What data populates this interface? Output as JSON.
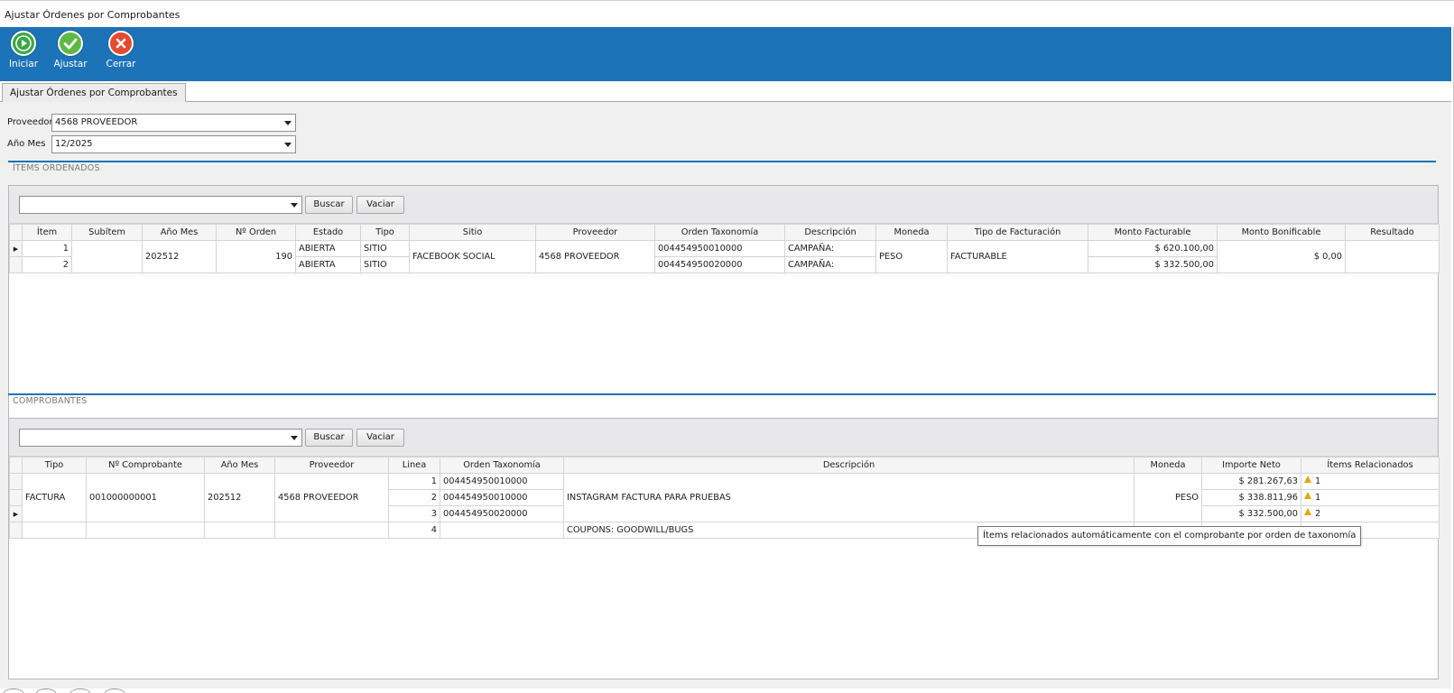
{
  "window": {
    "title": "Ajustar Órdenes por Comprobantes"
  },
  "toolbar": {
    "iniciar_label": "Iniciar",
    "ajustar_label": "Ajustar",
    "cerrar_label": "Cerrar",
    "colors": {
      "ribbon": "#1c73b7",
      "iniciar": "#3aa843",
      "ajustar": "#5fb845",
      "cerrar": "#e24b2f"
    }
  },
  "tab": {
    "label": "Ajustar Órdenes por Comprobantes"
  },
  "filters": {
    "proveedor_label": "Proveedor",
    "proveedor_value": "4568 PROVEEDOR",
    "anio_mes_label": "Año Mes",
    "anio_mes_value": "12/2025"
  },
  "items_section": {
    "title": "ÍTEMS ORDENADOS",
    "search_value": "",
    "buscar_label": "Buscar",
    "vaciar_label": "Vaciar",
    "columns": [
      "Ítem",
      "Subítem",
      "Año Mes",
      "Nº Orden",
      "Estado",
      "Tipo",
      "Sitio",
      "Proveedor",
      "Orden Taxonomía",
      "Descripción",
      "Moneda",
      "Tipo de Facturación",
      "Monto Facturable",
      "Monto Bonificable",
      "Resultado"
    ],
    "shared": {
      "anio_mes": "202512",
      "nro_orden": "190",
      "sitio": "FACEBOOK SOCIAL",
      "proveedor": "4568 PROVEEDOR",
      "moneda": "PESO",
      "tipo_facturacion": "FACTURABLE",
      "monto_bonificable": "$ 0,00",
      "resultado": ""
    },
    "rows": [
      {
        "item": "1",
        "subitem": "",
        "estado": "ABIERTA",
        "tipo": "SITIO",
        "orden_taxonomia": "004454950010000",
        "descripcion": "CAMPAÑA:",
        "monto_facturable": "$ 620.100,00"
      },
      {
        "item": "2",
        "subitem": "",
        "estado": "ABIERTA",
        "tipo": "SITIO",
        "orden_taxonomia": "004454950020000",
        "descripcion": "CAMPAÑA:",
        "monto_facturable": "$ 332.500,00"
      }
    ]
  },
  "comprobantes_section": {
    "title": "COMPROBANTES",
    "search_value": "",
    "buscar_label": "Buscar",
    "vaciar_label": "Vaciar",
    "columns": [
      "Tipo",
      "Nº Comprobante",
      "Año Mes",
      "Proveedor",
      "Linea",
      "Orden Taxonomía",
      "Descripción",
      "Moneda",
      "Importe Neto",
      "Ítems Relacionados"
    ],
    "shared": {
      "tipo": "FACTURA",
      "nro_comprobante": "001000000001",
      "anio_mes": "202512",
      "proveedor": "4568 PROVEEDOR",
      "descripcion": "INSTAGRAM FACTURA PARA PRUEBAS",
      "moneda": "PESO"
    },
    "rows": [
      {
        "linea": "1",
        "orden_taxonomia": "004454950010000",
        "importe_neto": "$ 281.267,63",
        "items_relacionados": "1"
      },
      {
        "linea": "2",
        "orden_taxonomia": "004454950010000",
        "importe_neto": "$ 338.811,96",
        "items_relacionados": "1"
      },
      {
        "linea": "3",
        "orden_taxonomia": "004454950020000",
        "importe_neto": "$ 332.500,00",
        "items_relacionados": "2"
      },
      {
        "linea": "4",
        "orden_taxonomia": "",
        "descripcion": "COUPONS: GOODWILL/BUGS",
        "importe_neto": "",
        "items_relacionados": ""
      }
    ]
  },
  "tooltip": {
    "text": "Ítems relacionados automáticamente con el comprobante por orden de taxonomía"
  }
}
